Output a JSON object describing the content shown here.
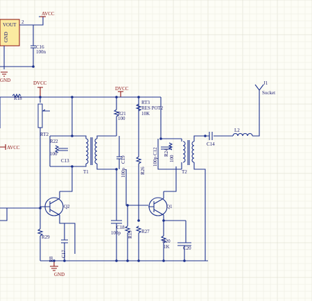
{
  "grid": {
    "minor": "#ececdf",
    "major": "#d6d6c6"
  },
  "colors": {
    "wire": "#1a2f8c",
    "component": "#1a2f8c",
    "power": "#8b1010",
    "label": "#1a1a70",
    "ic_fill": "#fbeaa0",
    "ic_stroke": "#8b1010"
  },
  "ic": {
    "pin_label": "VOUT",
    "gnd_label": "GND",
    "pin_number": "2"
  },
  "labels": {
    "avcc_top": "AVCC",
    "avcc_left": "AVCC",
    "dvcc_left": "DVCC",
    "dvcc_mid": "DVCC",
    "gnd_top": "GND",
    "gnd_bottom": "GND",
    "c16": "C16",
    "c16_val": "100n",
    "r18": "R18",
    "rt2": "RT2",
    "r22": "R22",
    "r22_val": "100",
    "c13": "C13",
    "t1": "T1",
    "r21": "R21",
    "r21_val": "100",
    "c19": "C19",
    "c19_val": "100p",
    "r26": "R26",
    "rt3": "RT3",
    "rt3_type": "RES POT2",
    "rt3_val": "10K",
    "c12": "C12",
    "c12_val": "100p",
    "r24": "R24",
    "r24_val": "100",
    "t2": "T2",
    "c14": "C14",
    "l2": "L2",
    "j1": "J1",
    "j1_val": "Socket",
    "q2": "Q2",
    "q1": "Q1",
    "r29": "R29",
    "c18": "C18",
    "c18_val": "100p",
    "r19": "R19",
    "r27": "R27",
    "r20": "R20",
    "r20_val": "1K",
    "c20": "C20",
    "r8": "R8",
    "c17": "C17"
  }
}
